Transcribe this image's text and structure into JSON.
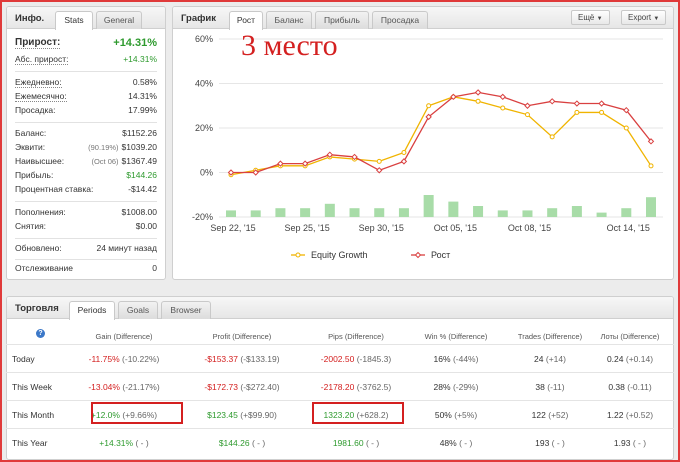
{
  "info": {
    "title": "Инфо.",
    "tabs": [
      "Stats",
      "General"
    ],
    "growth_label": "Прирост:",
    "growth_value": "+14.31%",
    "abs_growth_label": "Абс. прирост:",
    "abs_growth_value": "+14.31%",
    "daily_label": "Ежедневно:",
    "daily_value": "0.58%",
    "monthly_label": "Ежемесячно:",
    "monthly_value": "14.31%",
    "drawdown_label": "Просадка:",
    "drawdown_value": "17.99%",
    "balance_label": "Баланс:",
    "balance_value": "$1152.26",
    "equity_label": "Эквити:",
    "equity_sub": "(90.19%)",
    "equity_value": "$1039.20",
    "highest_label": "Наивысшее:",
    "highest_sub": "(Oct 06)",
    "highest_value": "$1367.49",
    "profit_label": "Прибыль:",
    "profit_value": "$144.26",
    "interest_label": "Процентная ставка:",
    "interest_value": "-$14.42",
    "deposits_label": "Пополнения:",
    "deposits_value": "$1008.00",
    "withdrawals_label": "Снятия:",
    "withdrawals_value": "$0.00",
    "updated_label": "Обновлено:",
    "updated_value": "24 минут назад",
    "tracking_label": "Отслеживание",
    "tracking_value": "0"
  },
  "chart_panel": {
    "title": "График",
    "tabs": [
      "Рост",
      "Баланс",
      "Прибыль",
      "Просадка"
    ],
    "buttons": [
      "Ещё",
      "Export"
    ],
    "overlay": "3 место"
  },
  "chart_data": {
    "type": "line",
    "y_ticks": [
      "60%",
      "40%",
      "20%",
      "0%",
      "-20%"
    ],
    "ylim": [
      -20,
      60
    ],
    "x_ticks": [
      "Sep 22, '15",
      "Sep 25, '15",
      "Sep 30, '15",
      "Oct 05, '15",
      "Oct 08, '15",
      "Oct 14, '15"
    ],
    "series": [
      {
        "name": "Equity Growth",
        "color": "#f0b400",
        "values": [
          -1,
          1,
          3,
          3,
          7,
          6,
          5,
          9,
          30,
          34,
          32,
          29,
          26,
          16,
          27,
          27,
          20,
          3
        ]
      },
      {
        "name": "Рост",
        "color": "#d94040",
        "values": [
          0,
          0,
          4,
          4,
          8,
          7,
          1,
          5,
          25,
          34,
          36,
          34,
          30,
          32,
          31,
          31,
          28,
          14
        ]
      }
    ],
    "bars": [
      3,
      3,
      4,
      4,
      6,
      4,
      4,
      4,
      10,
      7,
      5,
      3,
      3,
      4,
      5,
      2,
      4,
      9
    ],
    "bar_color": "#a8dca8",
    "legend": "bottom"
  },
  "trading": {
    "title": "Торговля",
    "tabs": [
      "Periods",
      "Goals",
      "Browser"
    ],
    "help": "?",
    "headers": [
      "Gain (Difference)",
      "Profit (Difference)",
      "Pips (Difference)",
      "Win % (Difference)",
      "Trades (Difference)",
      "Лоты (Difference)"
    ],
    "rows": [
      {
        "label": "Today",
        "gain": "-11.75%",
        "gain_diff": "(-10.22%)",
        "profit": "-$153.37",
        "profit_diff": "(-$133.19)",
        "pips": "-2002.50",
        "pips_diff": "(-1845.3)",
        "win": "16%",
        "win_diff": "(-44%)",
        "trades": "24",
        "trades_diff": "(+14)",
        "lots": "0.24",
        "lots_diff": "(+0.14)"
      },
      {
        "label": "This Week",
        "gain": "-13.04%",
        "gain_diff": "(-21.17%)",
        "profit": "-$172.73",
        "profit_diff": "(-$272.40)",
        "pips": "-2178.20",
        "pips_diff": "(-3762.5)",
        "win": "28%",
        "win_diff": "(-29%)",
        "trades": "38",
        "trades_diff": "(-11)",
        "lots": "0.38",
        "lots_diff": "(-0.11)"
      },
      {
        "label": "This Month",
        "gain": "+12.0%",
        "gain_diff": "(+9.66%)",
        "profit": "$123.45",
        "profit_diff": "(+$99.90)",
        "pips": "1323.20",
        "pips_diff": "(+628.2)",
        "win": "50%",
        "win_diff": "(+5%)",
        "trades": "122",
        "trades_diff": "(+52)",
        "lots": "1.22",
        "lots_diff": "(+0.52)"
      },
      {
        "label": "This Year",
        "gain": "+14.31%",
        "gain_diff": "( - )",
        "profit": "$144.26",
        "profit_diff": "( - )",
        "pips": "1981.60",
        "pips_diff": "( - )",
        "win": "48%",
        "win_diff": "( - )",
        "trades": "193",
        "trades_diff": "( - )",
        "lots": "1.93",
        "lots_diff": "( - )"
      }
    ]
  }
}
